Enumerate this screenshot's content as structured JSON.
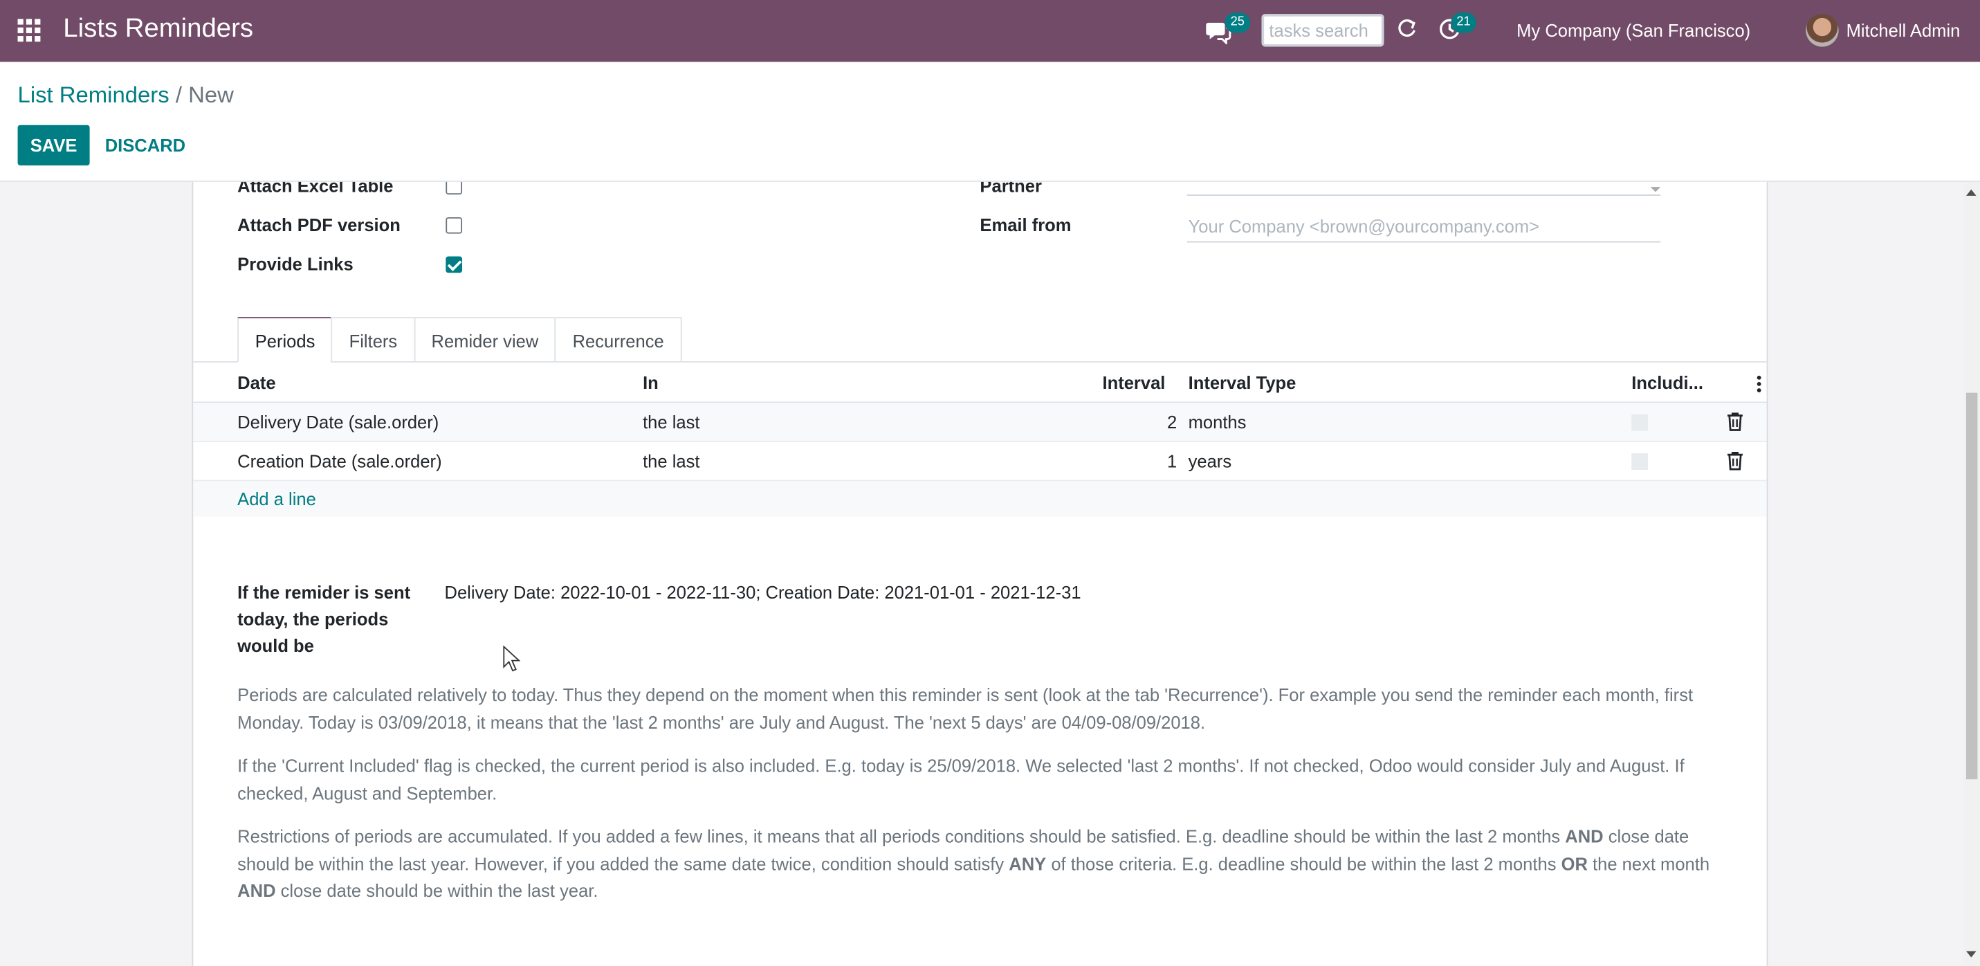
{
  "navbar": {
    "app_title": "Lists Reminders",
    "messages_count": "25",
    "search_placeholder": "tasks search",
    "activities_count": "21",
    "company": "My Company (San Francisco)",
    "user": "Mitchell Admin"
  },
  "breadcrumb": {
    "parent": "List Reminders",
    "separator": "/",
    "current": "New"
  },
  "buttons": {
    "save": "SAVE",
    "discard": "DISCARD"
  },
  "options": {
    "attach_excel_label": "Attach Excel Table",
    "attach_excel_checked": false,
    "attach_pdf_label": "Attach PDF version",
    "attach_pdf_checked": false,
    "provide_links_label": "Provide Links",
    "provide_links_checked": true
  },
  "right_fields": {
    "partner_label": "Partner",
    "partner_value": "",
    "email_from_label": "Email from",
    "email_from_placeholder": "Your Company <brown@yourcompany.com>"
  },
  "tabs": [
    "Periods",
    "Filters",
    "Remider view",
    "Recurrence"
  ],
  "active_tab": "Periods",
  "table": {
    "columns": [
      "Date",
      "In",
      "Interval",
      "Interval Type",
      "Includi..."
    ],
    "rows": [
      {
        "date": "Delivery Date (sale.order)",
        "in": "the last",
        "interval": "2",
        "interval_type": "months",
        "included": false
      },
      {
        "date": "Creation Date (sale.order)",
        "in": "the last",
        "interval": "1",
        "interval_type": "years",
        "included": false
      }
    ],
    "add_line": "Add a line"
  },
  "periods_summary": {
    "label": "If the remider is sent today, the periods would be",
    "value": "Delivery Date: 2022-10-01 - 2022-11-30; Creation Date: 2021-01-01 - 2021-12-31"
  },
  "help": {
    "p1": "Periods are calculated relatively to today. Thus they depend on the moment when this reminder is sent (look at the tab 'Recurrence'). For example you send the reminder each month, first Monday. Today is 03/09/2018, it means that the 'last 2 months' are July and August. The 'next 5 days' are 04/09-08/09/2018.",
    "p2": "If the 'Current Included' flag is checked, the current period is also included. E.g. today is 25/09/2018. We selected 'last 2 months'. If not checked, Odoo would consider July and August. If checked, August and September.",
    "p3_a": "Restrictions of periods are accumulated. If you added a few lines, it means that all periods conditions should be satisfied. E.g. deadline should be within the last 2 months ",
    "p3_and1": "AND",
    "p3_b": " close date should be within the last year. However, if you added the same date twice, condition should satisfy ",
    "p3_any": "ANY",
    "p3_c": " of those criteria. E.g. deadline should be within the last 2 months ",
    "p3_or": "OR",
    "p3_d": " the next month ",
    "p3_and2": "AND",
    "p3_e": " close date should be within the last year."
  },
  "colors": {
    "navbar": "#714b67",
    "accent": "#017e84"
  }
}
